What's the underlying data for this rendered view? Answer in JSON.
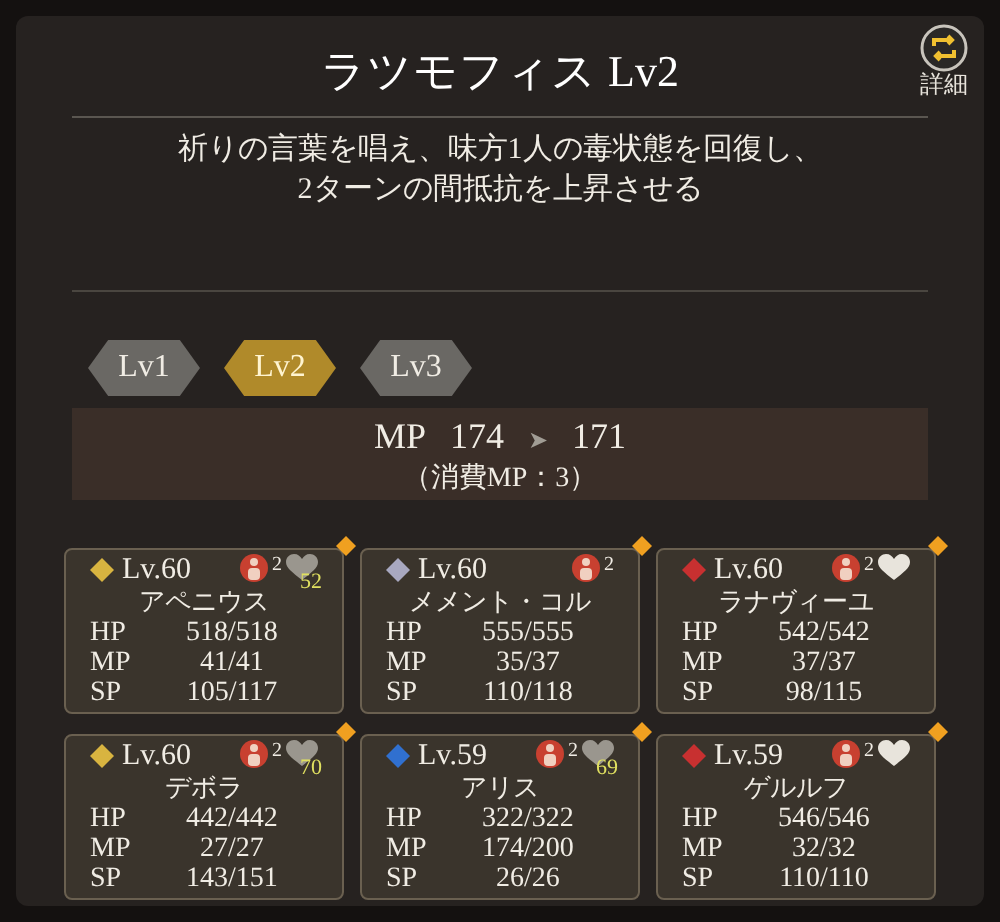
{
  "skill": {
    "title": "ラツモフィス Lv2",
    "description": "祈りの言葉を唱え、味方1人の毒状態を回復し、\n2ターンの間抵抗を上昇させる",
    "detail_label": "詳細"
  },
  "levels": [
    {
      "label": "Lv1",
      "selected": false
    },
    {
      "label": "Lv2",
      "selected": true
    },
    {
      "label": "Lv3",
      "selected": false
    }
  ],
  "cost": {
    "mp_label": "MP",
    "from": "174",
    "arrow": "➤",
    "to": "171",
    "note": "（消費MP：3）"
  },
  "members": [
    {
      "level": "Lv.60",
      "name": "アペニウス",
      "color": "#d8b440",
      "boost": "2",
      "affinity": "52",
      "stats": [
        {
          "label": "HP",
          "value": "518/518"
        },
        {
          "label": "MP",
          "value": "41/41"
        },
        {
          "label": "SP",
          "value": "105/117"
        }
      ]
    },
    {
      "level": "Lv.60",
      "name": "メメント・コル",
      "color": "#a8a8c0",
      "boost": "2",
      "stats": [
        {
          "label": "HP",
          "value": "555/555"
        },
        {
          "label": "MP",
          "value": "35/37"
        },
        {
          "label": "SP",
          "value": "110/118"
        }
      ]
    },
    {
      "level": "Lv.60",
      "name": "ラナヴィーユ",
      "color": "#c83030",
      "boost": "2",
      "affinity_heart": true,
      "stats": [
        {
          "label": "HP",
          "value": "542/542"
        },
        {
          "label": "MP",
          "value": "37/37"
        },
        {
          "label": "SP",
          "value": "98/115"
        }
      ]
    },
    {
      "level": "Lv.60",
      "name": "デボラ",
      "color": "#d8b440",
      "boost": "2",
      "affinity": "70",
      "stats": [
        {
          "label": "HP",
          "value": "442/442"
        },
        {
          "label": "MP",
          "value": "27/27"
        },
        {
          "label": "SP",
          "value": "143/151"
        }
      ]
    },
    {
      "level": "Lv.59",
      "name": "アリス",
      "color": "#3070d0",
      "boost": "2",
      "affinity": "69",
      "stats": [
        {
          "label": "HP",
          "value": "322/322"
        },
        {
          "label": "MP",
          "value": "174/200"
        },
        {
          "label": "SP",
          "value": "26/26"
        }
      ]
    },
    {
      "level": "Lv.59",
      "name": "ゲルルフ",
      "color": "#c83030",
      "boost": "2",
      "affinity_heart": true,
      "stats": [
        {
          "label": "HP",
          "value": "546/546"
        },
        {
          "label": "MP",
          "value": "32/32"
        },
        {
          "label": "SP",
          "value": "110/110"
        }
      ]
    }
  ]
}
